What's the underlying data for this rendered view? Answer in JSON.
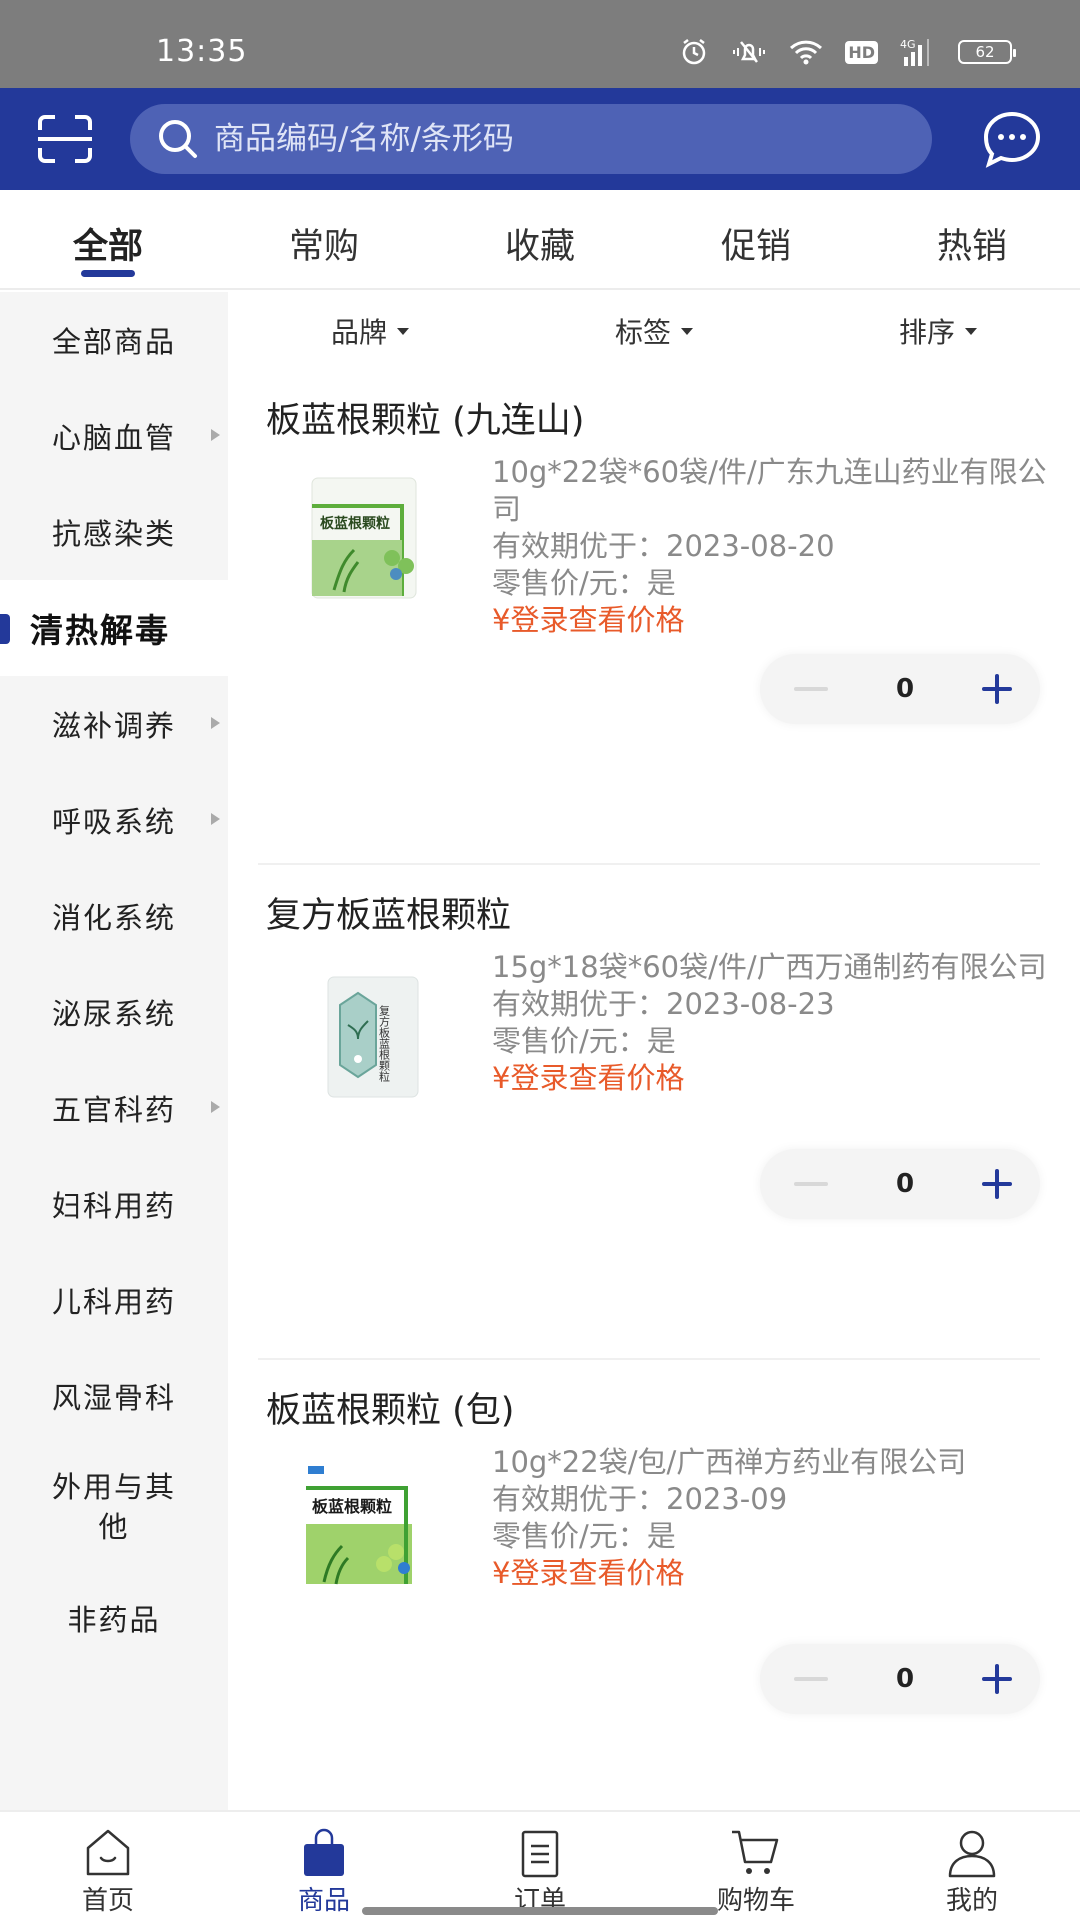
{
  "status_bar": {
    "time": "13:35",
    "icons": [
      "alarm-icon",
      "mute-icon",
      "wifi-icon",
      "hd-icon",
      "signal-4g-icon",
      "battery-icon"
    ],
    "hd_label": "HD",
    "network_label": "4G",
    "battery_level": "62"
  },
  "header": {
    "scan_icon": "scan-icon",
    "search_placeholder": "商品编码/名称/条形码",
    "message_icon": "chat-bubble-icon"
  },
  "tabs": [
    {
      "label": "全部",
      "active": true
    },
    {
      "label": "常购",
      "active": false
    },
    {
      "label": "收藏",
      "active": false
    },
    {
      "label": "促销",
      "active": false
    },
    {
      "label": "热销",
      "active": false
    }
  ],
  "filters": [
    {
      "label": "品牌"
    },
    {
      "label": "标签"
    },
    {
      "label": "排序"
    }
  ],
  "sidebar": {
    "items": [
      {
        "label": "全部商品",
        "has_arrow": false
      },
      {
        "label": "心脑血管",
        "has_arrow": true
      },
      {
        "label": "抗感染类",
        "has_arrow": false
      },
      {
        "label": "清热解毒",
        "has_arrow": false,
        "active": true
      },
      {
        "label": "滋补调养",
        "has_arrow": true
      },
      {
        "label": "呼吸系统",
        "has_arrow": true
      },
      {
        "label": "消化系统",
        "has_arrow": false
      },
      {
        "label": "泌尿系统",
        "has_arrow": false
      },
      {
        "label": "五官科药",
        "has_arrow": true
      },
      {
        "label": "妇科用药",
        "has_arrow": false
      },
      {
        "label": "儿科用药",
        "has_arrow": false
      },
      {
        "label": "风湿骨科",
        "has_arrow": false
      },
      {
        "label": "外用与其他",
        "has_arrow": false
      },
      {
        "label": "非药品",
        "has_arrow": false
      }
    ]
  },
  "products": [
    {
      "title": "板蓝根颗粒 (九连山)",
      "spec": "10g*22袋*60袋/件/广东九连山药业有限公司",
      "expiry": "有效期优于：2023-08-20",
      "retail": "零售价/元：是",
      "price": "¥登录查看价格",
      "quantity": "0",
      "image_label": "板蓝根颗粒"
    },
    {
      "title": "复方板蓝根颗粒",
      "spec": "15g*18袋*60袋/件/广西万通制药有限公司",
      "expiry": "有效期优于：2023-08-23",
      "retail": "零售价/元：是",
      "price": "¥登录查看价格",
      "quantity": "0",
      "image_label": "复方板蓝根颗粒"
    },
    {
      "title": "板蓝根颗粒 (包)",
      "spec": "10g*22袋/包/广西禅方药业有限公司",
      "expiry": "有效期优于：2023-09",
      "retail": "零售价/元：是",
      "price": "¥登录查看价格",
      "quantity": "0",
      "image_label": "板蓝根颗粒"
    }
  ],
  "bottom_nav": [
    {
      "label": "首页",
      "icon": "home-icon",
      "active": false
    },
    {
      "label": "商品",
      "icon": "shopping-bag-icon",
      "active": true
    },
    {
      "label": "订单",
      "icon": "order-list-icon",
      "active": false
    },
    {
      "label": "购物车",
      "icon": "cart-icon",
      "active": false
    },
    {
      "label": "我的",
      "icon": "user-icon",
      "active": false
    }
  ],
  "colors": {
    "brand": "#23399a",
    "price": "#e85a2a",
    "status_bar": "#7d7d7d"
  }
}
